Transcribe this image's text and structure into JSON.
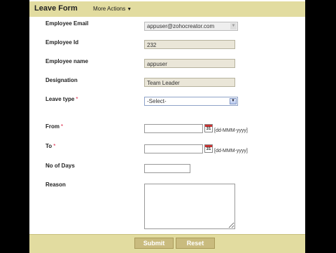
{
  "header": {
    "title": "Leave Form",
    "more_actions": "More Actions"
  },
  "fields": {
    "employee_email": {
      "label": "Employee Email",
      "value": "appuser@zohocreator.com"
    },
    "employee_id": {
      "label": "Employee Id",
      "value": "232"
    },
    "employee_name": {
      "label": "Employee name",
      "value": "appuser"
    },
    "designation": {
      "label": "Designation",
      "value": "Team Leader"
    },
    "leave_type": {
      "label": "Leave type",
      "required": "*",
      "value": "-Select-"
    },
    "from": {
      "label": "From",
      "required": "*",
      "value": "",
      "cal_day": "31",
      "format": "[dd-MMM-yyyy]"
    },
    "to": {
      "label": "To",
      "required": "*",
      "value": "",
      "cal_day": "31",
      "format": "[dd-MMM-yyyy]"
    },
    "no_of_days": {
      "label": "No of Days",
      "value": ""
    },
    "reason": {
      "label": "Reason",
      "value": ""
    }
  },
  "buttons": {
    "submit": "Submit",
    "reset": "Reset"
  },
  "colors": {
    "header_bg": "#e2dca0",
    "button_bg": "#c9bb7e",
    "required": "#dd2244"
  }
}
